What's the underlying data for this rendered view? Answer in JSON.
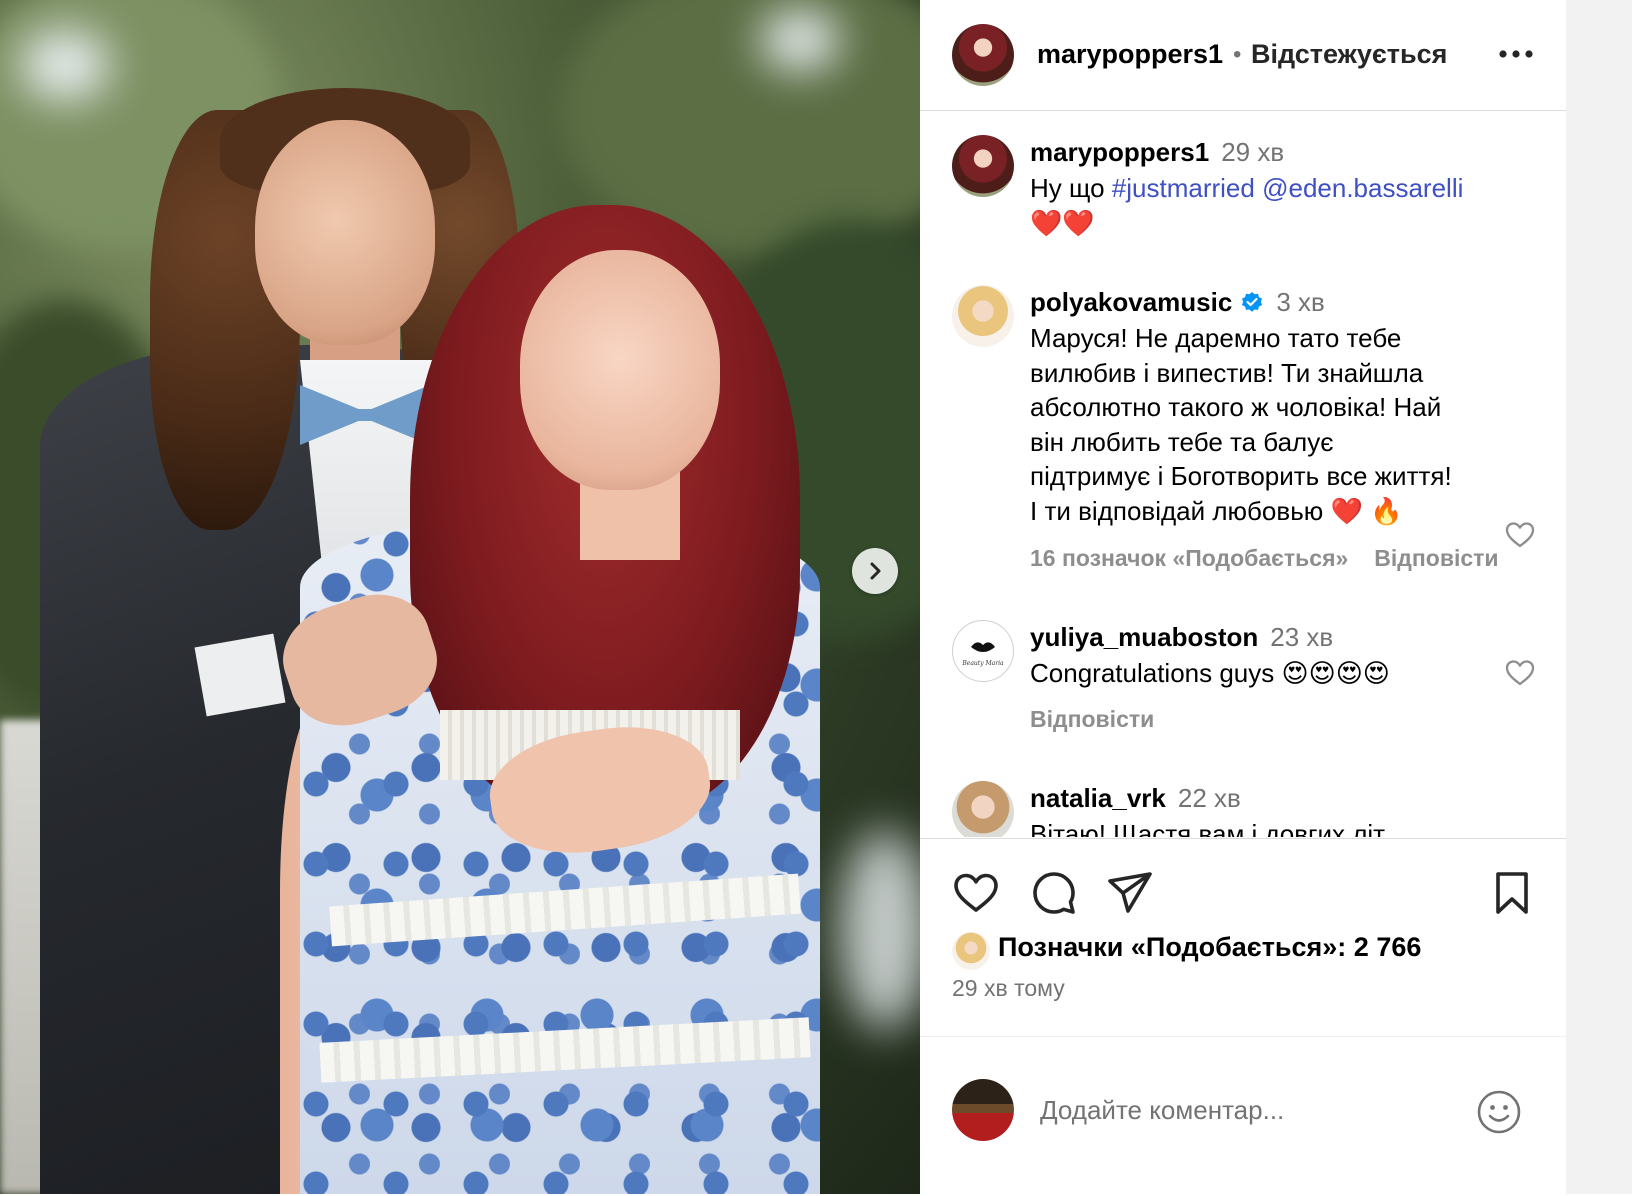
{
  "post": {
    "next_icon": "chevron-right-icon"
  },
  "header": {
    "username": "marypoppers1",
    "separator": "•",
    "follow_status": "Відстежується",
    "more_icon": "more-horizontal-icon"
  },
  "caption": {
    "username": "marypoppers1",
    "time": "29 хв",
    "text_start": "Ну що ",
    "hashtag": "#justmarried",
    "mention": "@eden.bassarelli",
    "emojis": "❤️❤️"
  },
  "comments": [
    {
      "username": "polyakovamusic",
      "verified": true,
      "time": "3 хв",
      "lines": [
        "Маруся! Не даремно тато тебе",
        "вилюбив і випестив! Ти знайшла",
        "абсолютно такого ж чоловіка! Най",
        "він любить тебе та балує",
        "підтримує і Боготворить все життя!",
        "І ти відповідай любовью ❤️ 🔥"
      ],
      "likes": "16 позначок «Подобається»",
      "reply": "Відповісти"
    },
    {
      "username": "yuliya_muaboston",
      "time": "23 хв",
      "text": "Congratulations guys 😍😍😍😍",
      "reply": "Відповісти",
      "avatar_text": "Beauty Maria"
    },
    {
      "username": "natalia_vrk",
      "time": "22 хв",
      "text": "Вітаю! Щастя вам і довгих літ"
    }
  ],
  "actions": {
    "like_icon": "heart-icon",
    "comment_icon": "comment-icon",
    "share_icon": "share-icon",
    "save_icon": "bookmark-icon",
    "likes_label": "Позначки «Подобається»: 2 766",
    "posted_ago": "29 хв тому"
  },
  "add_comment": {
    "placeholder": "Додайте коментар...",
    "emoji_icon": "emoji-icon"
  },
  "colors": {
    "link": "#3f4fc4",
    "secondary_text": "#737373",
    "verified": "#0095f6",
    "divider": "#dbdbdb"
  }
}
